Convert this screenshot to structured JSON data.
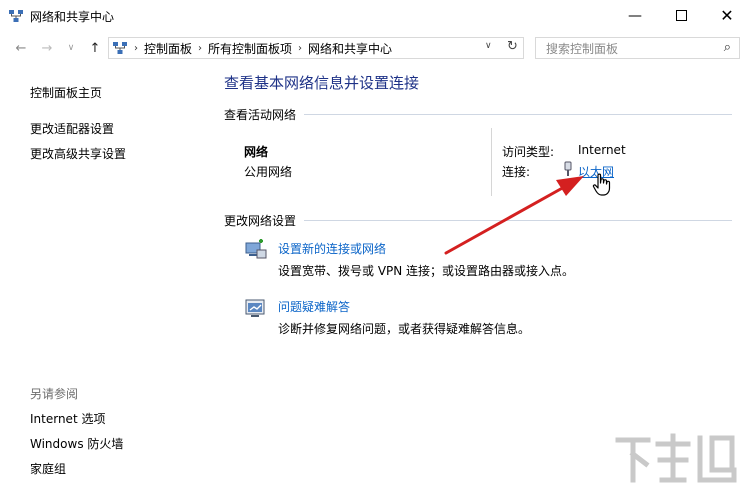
{
  "window": {
    "title": "网络和共享中心"
  },
  "address": {
    "crumbs": [
      "控制面板",
      "所有控制面板项",
      "网络和共享中心"
    ],
    "search_placeholder": "搜索控制面板"
  },
  "sidebar": {
    "home": "控制面板主页",
    "items": [
      "更改适配器设置",
      "更改高级共享设置"
    ],
    "see_also_title": "另请参阅",
    "see_also": [
      "Internet 选项",
      "Windows 防火墙",
      "家庭组"
    ]
  },
  "main": {
    "title": "查看基本网络信息并设置连接",
    "active_section": "查看活动网络",
    "network_name": "网络",
    "network_type": "公用网络",
    "access_type_label": "访问类型:",
    "access_type_value": "Internet",
    "connection_label": "连接:",
    "connection_value": "以太网",
    "change_section": "更改网络设置",
    "tasks": [
      {
        "title": "设置新的连接或网络",
        "desc": "设置宽带、拨号或 VPN 连接；或设置路由器或接入点。"
      },
      {
        "title": "问题疑难解答",
        "desc": "诊断并修复网络问题，或者获得疑难解答信息。"
      }
    ]
  },
  "colors": {
    "link": "#0a64c8",
    "title": "#1e3287",
    "arrow": "#d42020"
  },
  "watermark": {
    "text": "下载吧"
  }
}
